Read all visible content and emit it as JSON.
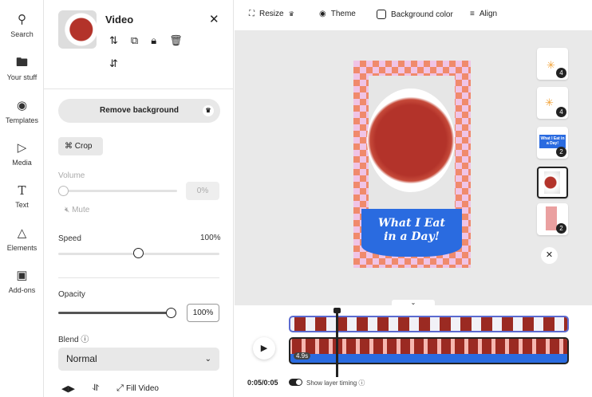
{
  "rail": [
    {
      "label": "Search",
      "icon": "search-icon"
    },
    {
      "label": "Your stuff",
      "icon": "folder-icon"
    },
    {
      "label": "Templates",
      "icon": "templates-icon"
    },
    {
      "label": "Media",
      "icon": "media-icon"
    },
    {
      "label": "Text",
      "icon": "text-icon"
    },
    {
      "label": "Elements",
      "icon": "elements-icon"
    },
    {
      "label": "Add-ons",
      "icon": "addons-icon"
    }
  ],
  "panel": {
    "title": "Video",
    "remove_bg": "Remove background",
    "crop": "Crop",
    "volume_label": "Volume",
    "volume_value": "0%",
    "mute": "Mute",
    "speed_label": "Speed",
    "speed_value": "100%",
    "speed_fraction": 0.5,
    "opacity_label": "Opacity",
    "opacity_value": "100%",
    "blend_label": "Blend",
    "blend_value": "Normal",
    "fill_video": "Fill Video"
  },
  "toolbar": {
    "resize": "Resize",
    "theme": "Theme",
    "bg_color": "Background color",
    "align": "Align"
  },
  "design": {
    "title_line1": "What I Eat",
    "title_line2": "in a Day!"
  },
  "layers": [
    {
      "badge": "4"
    },
    {
      "badge": "4"
    },
    {
      "badge": "2",
      "text": "What I Eat in a Day!"
    },
    {
      "badge": ""
    },
    {
      "badge": "2"
    }
  ],
  "timeline": {
    "time": "0:05/0:05",
    "show_layer_timing": "Show layer timing",
    "clip_duration": "4.9s"
  },
  "colors": {
    "accent_blue": "#2a6be0",
    "checker_orange": "#f08a6c",
    "checker_pink": "#f0c4e6"
  }
}
